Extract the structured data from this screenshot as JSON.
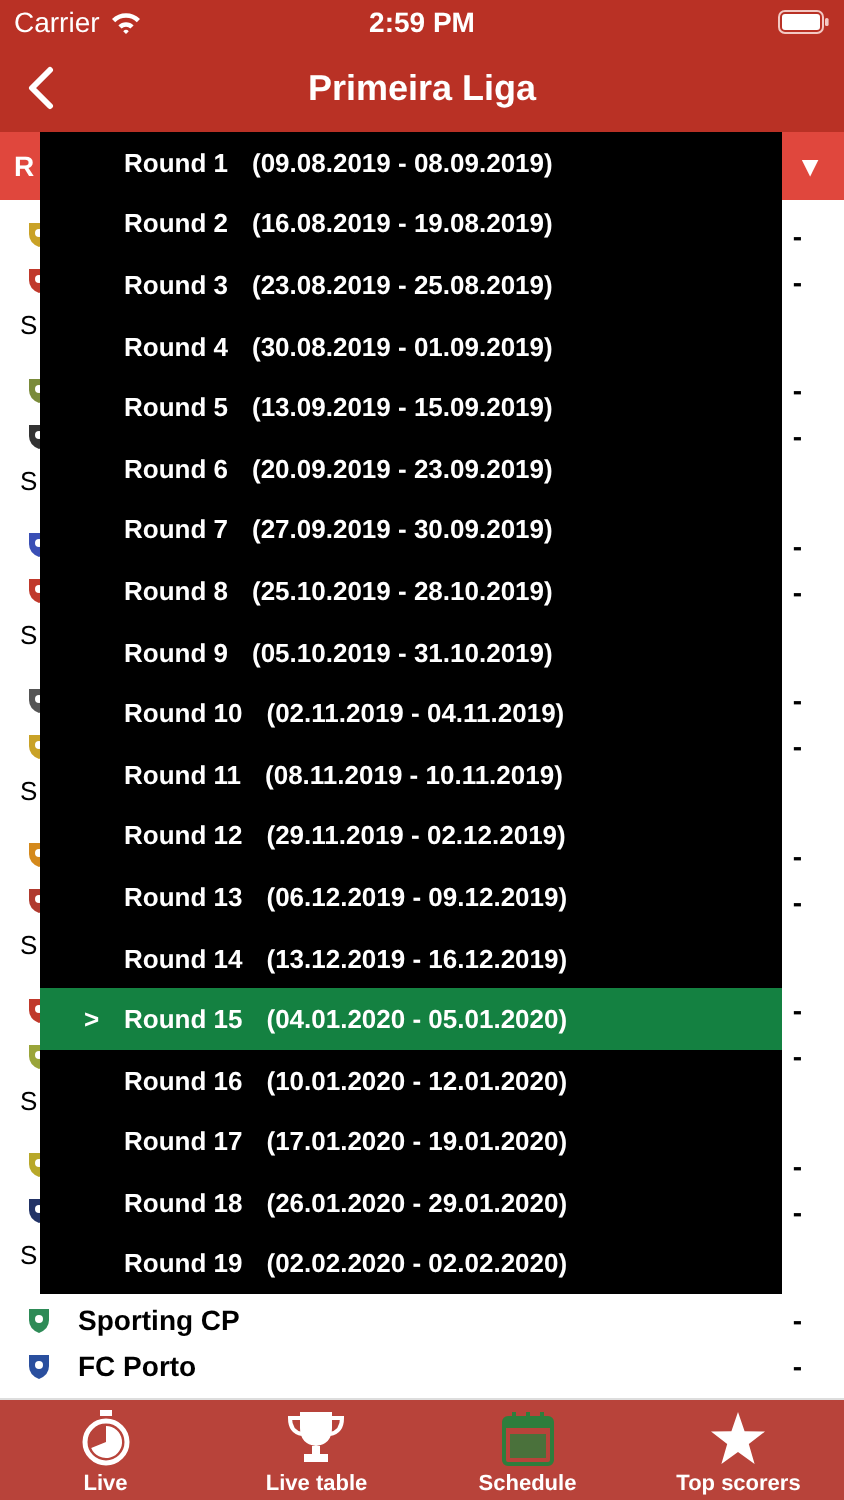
{
  "status_bar": {
    "carrier": "Carrier",
    "time": "2:59 PM"
  },
  "nav": {
    "title": "Primeira Liga"
  },
  "round_selector": {
    "label": "R",
    "caret": "▼"
  },
  "matches": [
    {
      "home": {
        "score": "-"
      },
      "away": {
        "score": "-"
      },
      "info": "S"
    },
    {
      "home": {
        "score": "-"
      },
      "away": {
        "score": "-"
      },
      "info": "S"
    },
    {
      "home": {
        "score": "-"
      },
      "away": {
        "score": "-"
      },
      "info": "S"
    },
    {
      "home": {
        "score": "-"
      },
      "away": {
        "score": "-"
      },
      "info": "S"
    },
    {
      "home": {
        "score": "-"
      },
      "away": {
        "score": "-"
      },
      "info": "S"
    },
    {
      "home": {
        "score": "-"
      },
      "away": {
        "score": "-"
      },
      "info": "S"
    },
    {
      "home": {
        "score": "-"
      },
      "away": {
        "score": "-"
      },
      "info": "S"
    },
    {
      "home": {
        "name": "Sporting CP",
        "score": "-"
      },
      "away": {
        "name": "FC Porto",
        "score": "-"
      }
    }
  ],
  "dropdown": {
    "selected_marker": ">",
    "items": [
      {
        "round": "Round 1",
        "dates": "(09.08.2019 - 08.09.2019)",
        "selected": false
      },
      {
        "round": "Round 2",
        "dates": "(16.08.2019 - 19.08.2019)",
        "selected": false
      },
      {
        "round": "Round 3",
        "dates": "(23.08.2019 - 25.08.2019)",
        "selected": false
      },
      {
        "round": "Round 4",
        "dates": "(30.08.2019 - 01.09.2019)",
        "selected": false
      },
      {
        "round": "Round 5",
        "dates": "(13.09.2019 - 15.09.2019)",
        "selected": false
      },
      {
        "round": "Round 6",
        "dates": "(20.09.2019 - 23.09.2019)",
        "selected": false
      },
      {
        "round": "Round 7",
        "dates": "(27.09.2019 - 30.09.2019)",
        "selected": false
      },
      {
        "round": "Round 8",
        "dates": "(25.10.2019 - 28.10.2019)",
        "selected": false
      },
      {
        "round": "Round 9",
        "dates": "(05.10.2019 - 31.10.2019)",
        "selected": false
      },
      {
        "round": "Round 10",
        "dates": "(02.11.2019 - 04.11.2019)",
        "selected": false
      },
      {
        "round": "Round 11",
        "dates": "(08.11.2019 - 10.11.2019)",
        "selected": false
      },
      {
        "round": "Round 12",
        "dates": "(29.11.2019 - 02.12.2019)",
        "selected": false
      },
      {
        "round": "Round 13",
        "dates": "(06.12.2019 - 09.12.2019)",
        "selected": false
      },
      {
        "round": "Round 14",
        "dates": "(13.12.2019 - 16.12.2019)",
        "selected": false
      },
      {
        "round": "Round 15",
        "dates": "(04.01.2020 - 05.01.2020)",
        "selected": true
      },
      {
        "round": "Round 16",
        "dates": "(10.01.2020 - 12.01.2020)",
        "selected": false
      },
      {
        "round": "Round 17",
        "dates": "(17.01.2020 - 19.01.2020)",
        "selected": false
      },
      {
        "round": "Round 18",
        "dates": "(26.01.2020 - 29.01.2020)",
        "selected": false
      },
      {
        "round": "Round 19",
        "dates": "(02.02.2020 - 02.02.2020)",
        "selected": false
      }
    ]
  },
  "tabs": [
    {
      "kind": "stopwatch",
      "label": "Live",
      "selected": false
    },
    {
      "kind": "trophy",
      "label": "Live table",
      "selected": false
    },
    {
      "kind": "calendar",
      "label": "Schedule",
      "selected": true
    },
    {
      "kind": "star",
      "label": "Top scorers",
      "selected": false
    }
  ]
}
